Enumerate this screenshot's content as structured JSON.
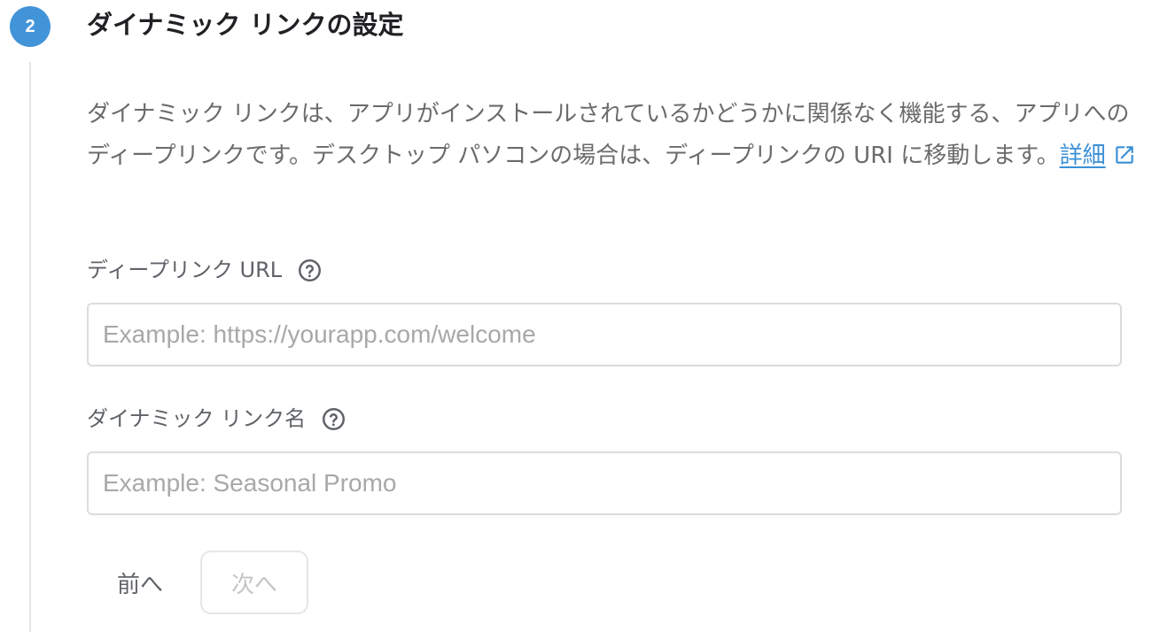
{
  "step": {
    "number": "2",
    "title": "ダイナミック リンクの設定",
    "accent_color": "#4294d9"
  },
  "description": {
    "text": "ダイナミック リンクは、アプリがインストールされているかどうかに関係なく機能する、アプリへのディープリンクです。デスクトップ パソコンの場合は、ディープリンクの URI に移動します。",
    "learn_more": "詳細",
    "learn_more_icon": "open-in-new-icon",
    "link_color": "#3a8fd6"
  },
  "fields": {
    "deep_link": {
      "label": "ディープリンク URL",
      "help_icon": "help-circle-icon",
      "value": "",
      "placeholder": "Example: https://yourapp.com/welcome"
    },
    "link_name": {
      "label": "ダイナミック リンク名",
      "help_icon": "help-circle-icon",
      "value": "",
      "placeholder": "Example: Seasonal Promo"
    }
  },
  "buttons": {
    "back": "前へ",
    "next": "次へ"
  }
}
